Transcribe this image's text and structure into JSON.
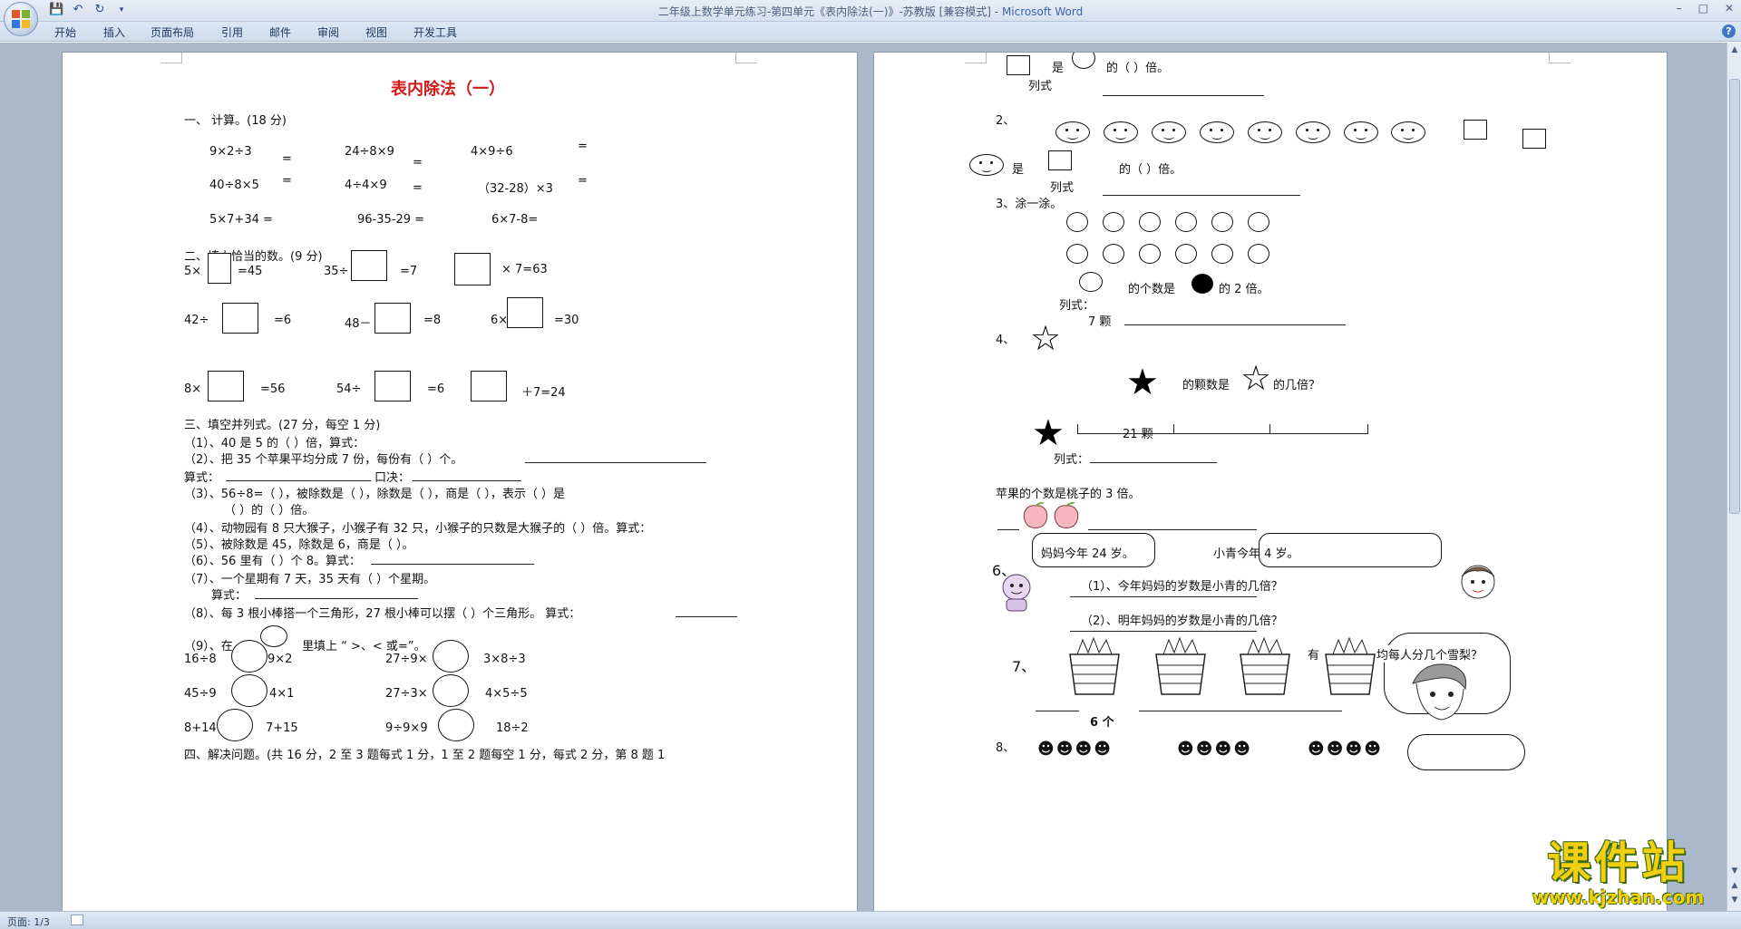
{
  "window": {
    "title": "二年级上数学单元练习-第四单元《表内除法(一)》-苏教版 [兼容模式] - ",
    "app_name": "Microsoft Word"
  },
  "ribbon": {
    "tabs": [
      "开始",
      "插入",
      "页面布局",
      "引用",
      "邮件",
      "审阅",
      "视图",
      "开发工具"
    ]
  },
  "statusbar": {
    "page": "页面: 1/3"
  },
  "watermark": {
    "main": "课件站",
    "sub": "www.kjzhan.com"
  },
  "page1": {
    "title": "表内除法（一）",
    "s1_heading": "一、    计算。(18 分)",
    "s1": [
      "9×2÷3",
      "=",
      "24÷8×9",
      "=",
      "4×9÷6",
      "=",
      "40÷8×5",
      "=",
      "4÷4×9",
      "=",
      "（32-28）×3",
      "=",
      "5×7+34 =",
      "96-35-29 =",
      "6×7-8="
    ],
    "s2_heading": "二、填上恰当的数。(9 分)",
    "s2": [
      "5×",
      "=45",
      "35÷",
      "=7",
      "×  7=63",
      "42÷",
      "=6",
      "48－",
      "=8",
      "6×",
      "=30",
      "8×",
      "=56",
      "54÷",
      "=6",
      "＋7=24"
    ],
    "s3_heading": "三、填空并列式。(27 分，每空 1 分)",
    "s3": [
      "（1）、40 是 5 的（      ）倍，算式：",
      "（2）、把 35 个苹果平均分成 7 份，每份有（      ）个。",
      "算式：",
      "口决：",
      "（3）、56÷8=（      ），被除数是（      ），除数是（      ），商是（    ），表示（      ）是",
      "（      ）的（      ）倍。",
      "（4）、动物园有 8 只大猴子，小猴子有 32 只，小猴子的只数是大猴子的（      ）倍。算式：",
      "（5）、被除数是 45，除数是 6，商是（      ）。",
      "（6）、56 里有（      ）个 8。算式：",
      "（7）、一个星期有 7 天，35 天有（      ）个星期。",
      "算式：",
      "（8）、每 3 根小棒搭一个三角形，27 根小棒可以摆（      ）个三角形。      算式：",
      "（9）、在",
      "里填上 “    >、< 或=”。",
      "16÷8",
      "9×2",
      "27÷9×",
      "3×8÷3",
      "45÷9",
      "4×1",
      "27÷3×",
      "4×5÷5",
      "8+14",
      "7+15",
      "9÷9×9",
      "18÷2"
    ],
    "s4_heading": "四、解决问题。(共 16 分，2 至 3 题每式 1 分，1 至 2 题每空 1 分，每式 2 分，第 8 题 1"
  },
  "page2": {
    "q_top": [
      "是",
      "的（      ）倍。",
      "列式"
    ],
    "q2": [
      "2、",
      "是",
      "的（      ）倍。",
      "列式"
    ],
    "q3": [
      "3、涂一涂。",
      "的个数是",
      "的 2 倍。",
      "列式：",
      "7 颗"
    ],
    "q4": [
      "4、",
      "的颗数是",
      "的几倍？",
      "21 颗",
      "列式："
    ],
    "q5": [
      "苹果的个数是桃子的 3 倍。"
    ],
    "q6": [
      "6、",
      "妈妈今年 24 岁。",
      "小青今年 4 岁。",
      "（1）、今年妈妈的岁数是小青的几倍？",
      "（2）、明年妈妈的岁数是小青的几倍？"
    ],
    "q7": [
      "7、",
      "有",
      "均每人分几个雪梨？",
      "6 个"
    ],
    "q8": [
      "8、"
    ]
  }
}
